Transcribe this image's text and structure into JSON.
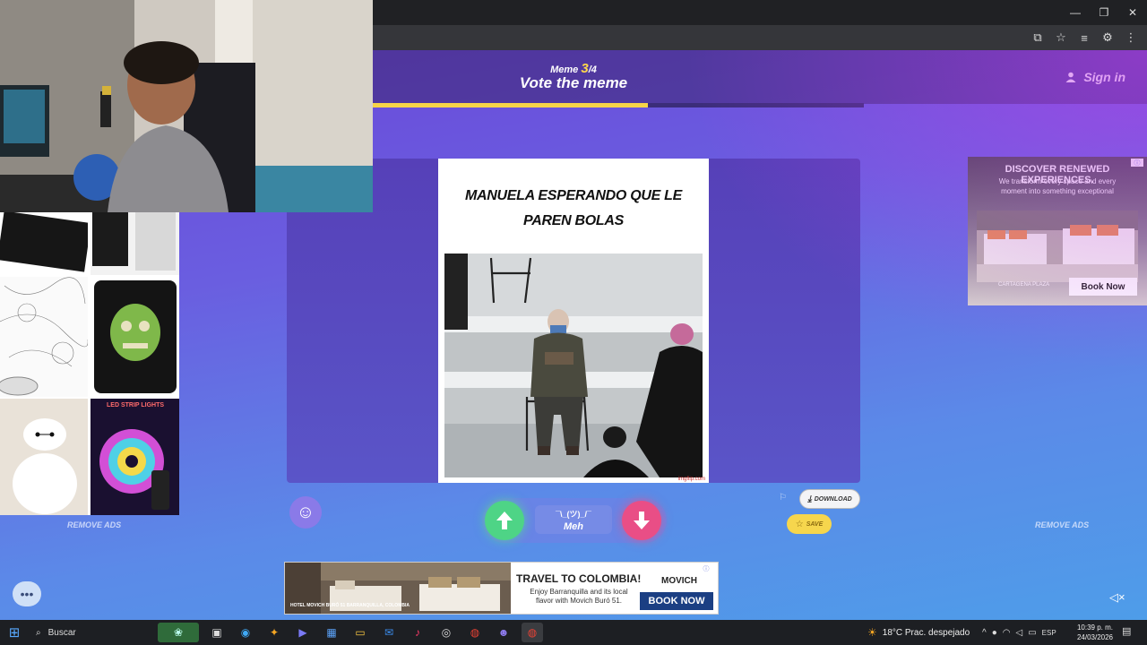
{
  "window": {
    "minimize_icon": "minimize-icon",
    "restore_icon": "restore-icon",
    "close_icon": "close-icon"
  },
  "meme_page": {
    "counter_word": "Meme",
    "counter_current": "3",
    "counter_total": "/4",
    "title": "Vote the meme",
    "sign_in": "Sign in",
    "progress_fraction": 0.56,
    "meme_caption": "MANUELA ESPERANDO QUE LE PAREN BOLAS",
    "watermark": "imgflip.com",
    "meh_face": "¯\\_(ツ)_/¯",
    "meh_label": "Meh",
    "download_label": "DOWNLOAD",
    "save_label": "SAVE",
    "remove_ads_left": "REMOVE ADS",
    "remove_ads_right": "REMOVE ADS"
  },
  "ad_right": {
    "title": "DISCOVER RENEWED EXPERIENCES.",
    "subtitle": "We transform every space and every moment into something exceptional",
    "brand": "CARTAGENA PLAZA",
    "cta": "Book Now"
  },
  "ad_bottom": {
    "image_tag": "HOTEL MOVICH BURÓ 51 BARRANQUILLA, COLOMBIA",
    "title": "TRAVEL TO COLOMBIA!",
    "subtitle": "Enjoy Barranquilla and its local flavor with Movich Buró 51.",
    "brand": "MOVICH",
    "cta": "BOOK NOW"
  },
  "products_ad": {
    "led_label": "LED STRIP LIGHTS"
  },
  "taskbar": {
    "search_placeholder": "Buscar",
    "weather": "18°C  Prac. despejado",
    "language": "ESP",
    "time": "10:39 p. m.",
    "date": "24/03/2026"
  },
  "colors": {
    "accent_yellow": "#f6d448",
    "upvote_green": "#4ed486",
    "downvote_pink": "#e94e86"
  }
}
